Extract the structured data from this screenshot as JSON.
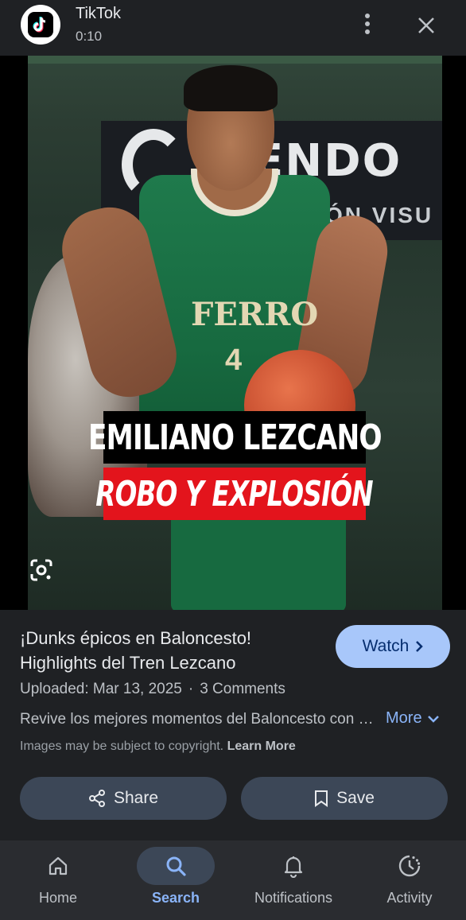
{
  "header": {
    "app_name": "TikTok",
    "time": "0:10",
    "logo_icon": "tiktok-logo-icon",
    "more_icon": "more-vert-icon",
    "close_icon": "close-icon"
  },
  "image": {
    "banner_text": "TIENDO",
    "banner_sub": "CIÓN VISU",
    "jersey_text": "FERRO",
    "jersey_number": "4",
    "caption_line1": "EMILIANO LEZCANO",
    "caption_line2": "ROBO Y EXPLOSIÓN",
    "lens_icon": "google-lens-icon"
  },
  "details": {
    "title": "¡Dunks épicos en Baloncesto! Highlights del Tren Lezcano",
    "watch_label": "Watch",
    "uploaded": "Uploaded: Mar 13, 2025",
    "separator": "·",
    "comments": "3 Comments",
    "description": "Revive los mejores momentos del Baloncesto con el Tren Lezcano",
    "more_label": "More",
    "copyright_text": "Images may be subject to copyright.",
    "learn_more": "Learn More",
    "share_label": "Share",
    "save_label": "Save"
  },
  "nav": {
    "items": [
      {
        "label": "Home",
        "icon": "home-icon",
        "active": false
      },
      {
        "label": "Search",
        "icon": "search-icon",
        "active": true
      },
      {
        "label": "Notifications",
        "icon": "bell-icon",
        "active": false
      },
      {
        "label": "Activity",
        "icon": "activity-icon",
        "active": false
      }
    ]
  },
  "colors": {
    "background": "#1f2124",
    "accent": "#8ab4f8",
    "watch_button": "#a8c7fa",
    "pill": "#3c4757",
    "caption_red": "#e3141c"
  }
}
